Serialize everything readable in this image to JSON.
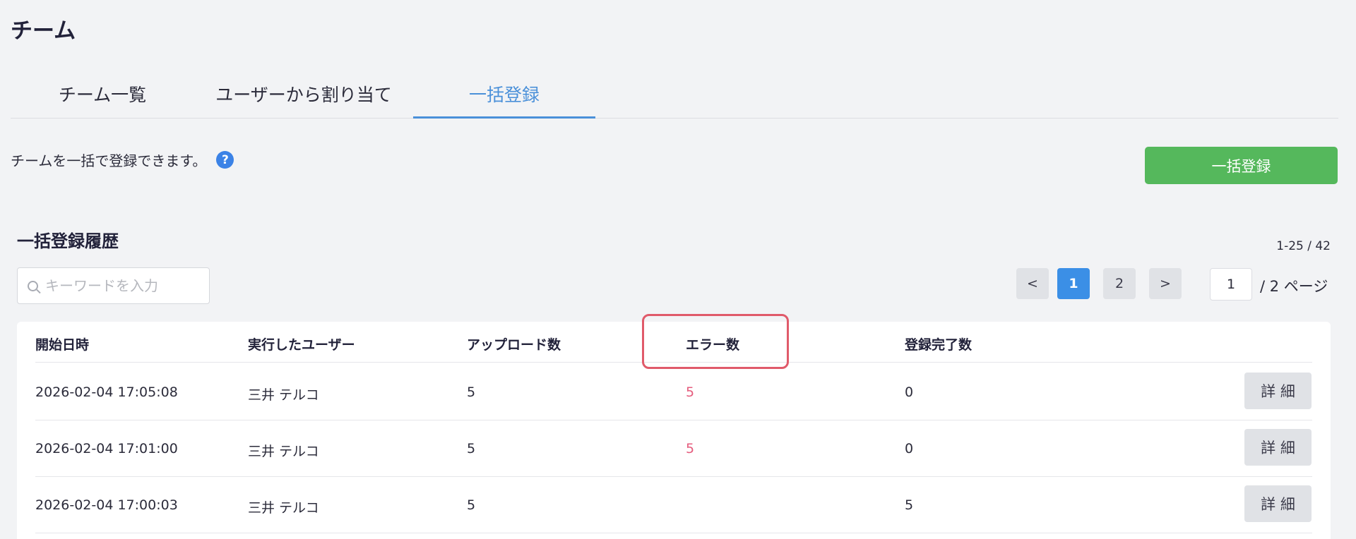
{
  "page_title": "チーム",
  "tabs": [
    {
      "label": "チーム一覧",
      "active": false
    },
    {
      "label": "ユーザーから割り当て",
      "active": false
    },
    {
      "label": "一括登録",
      "active": true
    }
  ],
  "description": "チームを一括で登録できます。",
  "help_icon": "?",
  "bulk_button": "一括登録",
  "section_title": "一括登録履歴",
  "range": "1-25 / 42",
  "search": {
    "placeholder": "キーワードを入力",
    "value": ""
  },
  "pagination": {
    "prev": "<",
    "pages": [
      "1",
      "2"
    ],
    "current": "1",
    "next": ">",
    "page_input": "1",
    "total": "/ 2 ページ"
  },
  "table": {
    "headers": [
      "開始日時",
      "実行したユーザー",
      "アップロード数",
      "エラー数",
      "登録完了数"
    ],
    "rows": [
      {
        "start": "2026-02-04 17:05:08",
        "user": "三井 テルコ",
        "uploads": "5",
        "errors": "5",
        "completed": "0",
        "detail": "詳 細"
      },
      {
        "start": "2026-02-04 17:01:00",
        "user": "三井 テルコ",
        "uploads": "5",
        "errors": "5",
        "completed": "0",
        "detail": "詳 細"
      },
      {
        "start": "2026-02-04 17:00:03",
        "user": "三井 テルコ",
        "uploads": "5",
        "errors": "",
        "completed": "5",
        "detail": "詳 細"
      }
    ]
  },
  "colors": {
    "accent": "#4a90d9",
    "success": "#55b85c",
    "error": "#e55c7d",
    "highlight": "#e05a6a"
  }
}
